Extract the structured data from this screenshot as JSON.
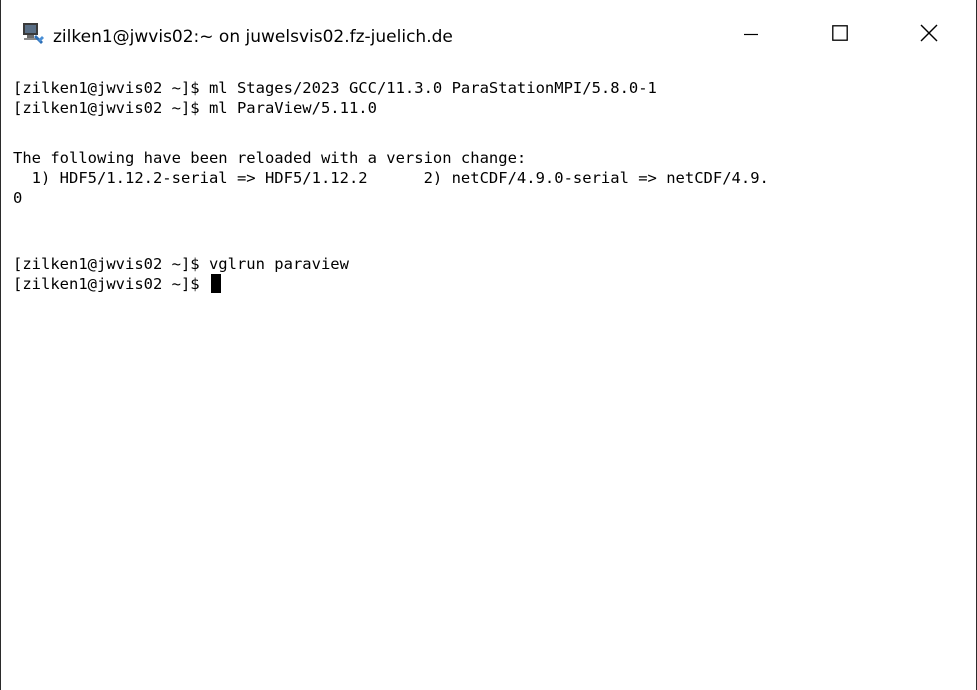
{
  "window": {
    "title": "zilken1@jwvis02:~ on juwelsvis02.fz-juelich.de",
    "icon": "terminal-window-icon",
    "controls": {
      "minimize": "minimize-icon",
      "maximize": "maximize-icon",
      "close": "close-icon"
    }
  },
  "terminal": {
    "lines": [
      "[zilken1@jwvis02 ~]$ ml Stages/2023 GCC/11.3.0 ParaStationMPI/5.8.0-1",
      "[zilken1@jwvis02 ~]$ ml ParaView/5.11.0",
      "",
      "The following have been reloaded with a version change:",
      "  1) HDF5/1.12.2-serial => HDF5/1.12.2      2) netCDF/4.9.0-serial => netCDF/4.9.",
      "0",
      "",
      "[zilken1@jwvis02 ~]$ vglrun paraview",
      "[zilken1@jwvis02 ~]$ "
    ],
    "colors": {
      "background": "#ffffff",
      "foreground": "#000000",
      "cursor": "#000000"
    }
  }
}
